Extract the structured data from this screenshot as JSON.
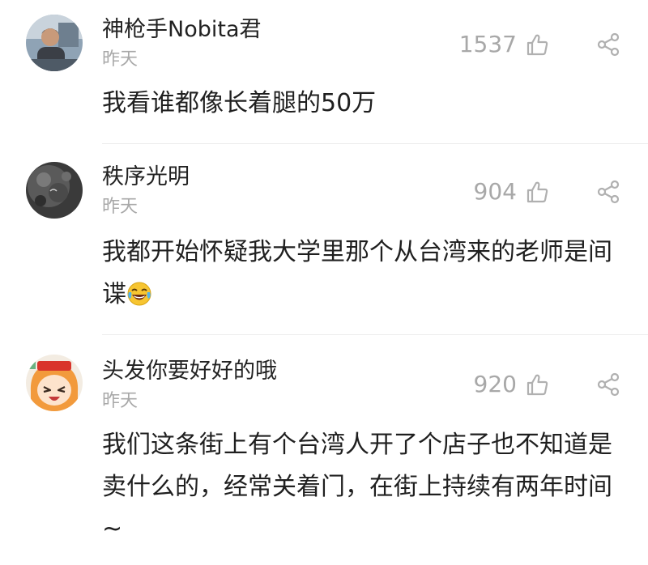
{
  "comments": [
    {
      "username": "神枪手Nobita君",
      "time": "昨天",
      "likes": "1537",
      "content": "我看谁都像长着腿的50万"
    },
    {
      "username": "秩序光明",
      "time": "昨天",
      "likes": "904",
      "content": "我都开始怀疑我大学里那个从台湾来的老师是间谍"
    },
    {
      "username": "头发你要好好的哦",
      "time": "昨天",
      "likes": "920",
      "content": "我们这条街上有个台湾人开了个店子也不知道是卖什么的，经常关着门，在街上持续有两年时间~"
    }
  ],
  "icons": {
    "like": "thumbs-up-outline-icon",
    "share": "share-icon",
    "emoji": "laughing-tears-emoji-icon"
  },
  "colors": {
    "text": "#222222",
    "muted": "#a8a8a8",
    "divider": "#ececec"
  }
}
